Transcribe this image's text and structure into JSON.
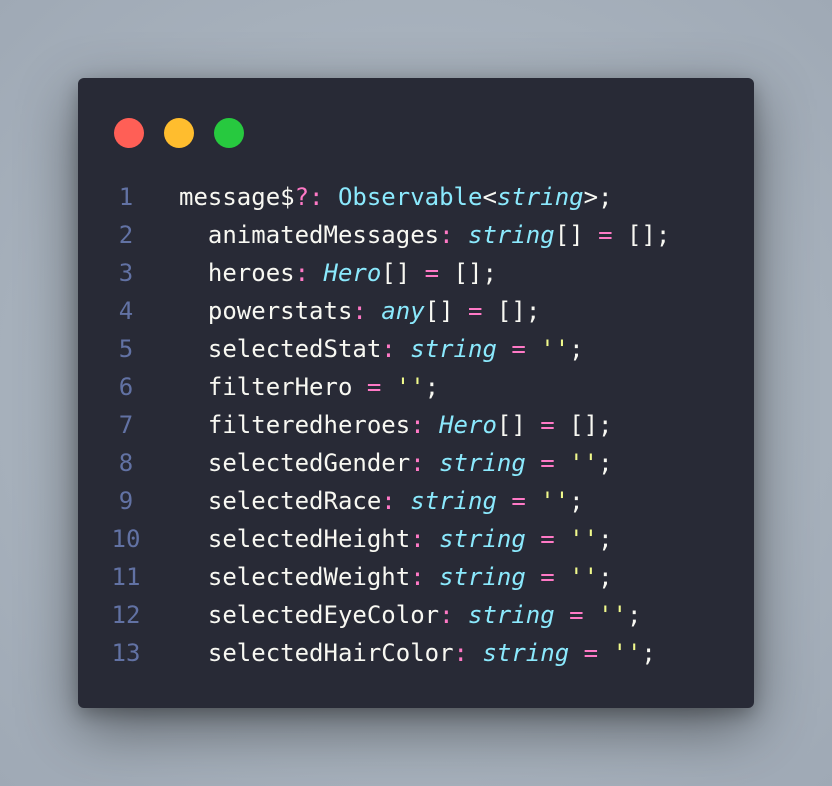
{
  "window": {
    "controls": [
      {
        "name": "close",
        "color": "#ff5f56"
      },
      {
        "name": "minimize",
        "color": "#ffbd2e"
      },
      {
        "name": "maximize",
        "color": "#27c93f"
      }
    ]
  },
  "theme": {
    "background": "#282a36",
    "identifier": "#f8f8f2",
    "keyword_punct": "#ff79c6",
    "type": "#8be9fd",
    "string": "#f1fa8c",
    "line_number": "#6272a4"
  },
  "code": {
    "lines": [
      {
        "number": "1",
        "tokens": [
          {
            "text": "message$",
            "kind": "ident"
          },
          {
            "text": "?:",
            "kind": "punc"
          },
          {
            "text": " ",
            "kind": "plain"
          },
          {
            "text": "Observable",
            "kind": "cls"
          },
          {
            "text": "<",
            "kind": "plain"
          },
          {
            "text": "string",
            "kind": "type"
          },
          {
            "text": ">;",
            "kind": "plain"
          }
        ]
      },
      {
        "number": "2",
        "tokens": [
          {
            "text": "  animatedMessages",
            "kind": "ident"
          },
          {
            "text": ":",
            "kind": "punc"
          },
          {
            "text": " ",
            "kind": "plain"
          },
          {
            "text": "string",
            "kind": "type"
          },
          {
            "text": "[] ",
            "kind": "plain"
          },
          {
            "text": "=",
            "kind": "punc"
          },
          {
            "text": " [];",
            "kind": "plain"
          }
        ]
      },
      {
        "number": "3",
        "tokens": [
          {
            "text": "  heroes",
            "kind": "ident"
          },
          {
            "text": ":",
            "kind": "punc"
          },
          {
            "text": " ",
            "kind": "plain"
          },
          {
            "text": "Hero",
            "kind": "type"
          },
          {
            "text": "[] ",
            "kind": "plain"
          },
          {
            "text": "=",
            "kind": "punc"
          },
          {
            "text": " [];",
            "kind": "plain"
          }
        ]
      },
      {
        "number": "4",
        "tokens": [
          {
            "text": "  powerstats",
            "kind": "ident"
          },
          {
            "text": ":",
            "kind": "punc"
          },
          {
            "text": " ",
            "kind": "plain"
          },
          {
            "text": "any",
            "kind": "type"
          },
          {
            "text": "[] ",
            "kind": "plain"
          },
          {
            "text": "=",
            "kind": "punc"
          },
          {
            "text": " [];",
            "kind": "plain"
          }
        ]
      },
      {
        "number": "5",
        "tokens": [
          {
            "text": "  selectedStat",
            "kind": "ident"
          },
          {
            "text": ":",
            "kind": "punc"
          },
          {
            "text": " ",
            "kind": "plain"
          },
          {
            "text": "string",
            "kind": "type"
          },
          {
            "text": " ",
            "kind": "plain"
          },
          {
            "text": "=",
            "kind": "punc"
          },
          {
            "text": " ",
            "kind": "plain"
          },
          {
            "text": "''",
            "kind": "str"
          },
          {
            "text": ";",
            "kind": "plain"
          }
        ]
      },
      {
        "number": "6",
        "tokens": [
          {
            "text": "  filterHero",
            "kind": "ident"
          },
          {
            "text": " ",
            "kind": "plain"
          },
          {
            "text": "=",
            "kind": "punc"
          },
          {
            "text": " ",
            "kind": "plain"
          },
          {
            "text": "''",
            "kind": "str"
          },
          {
            "text": ";",
            "kind": "plain"
          }
        ]
      },
      {
        "number": "7",
        "tokens": [
          {
            "text": "  filteredheroes",
            "kind": "ident"
          },
          {
            "text": ":",
            "kind": "punc"
          },
          {
            "text": " ",
            "kind": "plain"
          },
          {
            "text": "Hero",
            "kind": "type"
          },
          {
            "text": "[] ",
            "kind": "plain"
          },
          {
            "text": "=",
            "kind": "punc"
          },
          {
            "text": " [];",
            "kind": "plain"
          }
        ]
      },
      {
        "number": "8",
        "tokens": [
          {
            "text": "  selectedGender",
            "kind": "ident"
          },
          {
            "text": ":",
            "kind": "punc"
          },
          {
            "text": " ",
            "kind": "plain"
          },
          {
            "text": "string",
            "kind": "type"
          },
          {
            "text": " ",
            "kind": "plain"
          },
          {
            "text": "=",
            "kind": "punc"
          },
          {
            "text": " ",
            "kind": "plain"
          },
          {
            "text": "''",
            "kind": "str"
          },
          {
            "text": ";",
            "kind": "plain"
          }
        ]
      },
      {
        "number": "9",
        "tokens": [
          {
            "text": "  selectedRace",
            "kind": "ident"
          },
          {
            "text": ":",
            "kind": "punc"
          },
          {
            "text": " ",
            "kind": "plain"
          },
          {
            "text": "string",
            "kind": "type"
          },
          {
            "text": " ",
            "kind": "plain"
          },
          {
            "text": "=",
            "kind": "punc"
          },
          {
            "text": " ",
            "kind": "plain"
          },
          {
            "text": "''",
            "kind": "str"
          },
          {
            "text": ";",
            "kind": "plain"
          }
        ]
      },
      {
        "number": "10",
        "tokens": [
          {
            "text": "  selectedHeight",
            "kind": "ident"
          },
          {
            "text": ":",
            "kind": "punc"
          },
          {
            "text": " ",
            "kind": "plain"
          },
          {
            "text": "string",
            "kind": "type"
          },
          {
            "text": " ",
            "kind": "plain"
          },
          {
            "text": "=",
            "kind": "punc"
          },
          {
            "text": " ",
            "kind": "plain"
          },
          {
            "text": "''",
            "kind": "str"
          },
          {
            "text": ";",
            "kind": "plain"
          }
        ]
      },
      {
        "number": "11",
        "tokens": [
          {
            "text": "  selectedWeight",
            "kind": "ident"
          },
          {
            "text": ":",
            "kind": "punc"
          },
          {
            "text": " ",
            "kind": "plain"
          },
          {
            "text": "string",
            "kind": "type"
          },
          {
            "text": " ",
            "kind": "plain"
          },
          {
            "text": "=",
            "kind": "punc"
          },
          {
            "text": " ",
            "kind": "plain"
          },
          {
            "text": "''",
            "kind": "str"
          },
          {
            "text": ";",
            "kind": "plain"
          }
        ]
      },
      {
        "number": "12",
        "tokens": [
          {
            "text": "  selectedEyeColor",
            "kind": "ident"
          },
          {
            "text": ":",
            "kind": "punc"
          },
          {
            "text": " ",
            "kind": "plain"
          },
          {
            "text": "string",
            "kind": "type"
          },
          {
            "text": " ",
            "kind": "plain"
          },
          {
            "text": "=",
            "kind": "punc"
          },
          {
            "text": " ",
            "kind": "plain"
          },
          {
            "text": "''",
            "kind": "str"
          },
          {
            "text": ";",
            "kind": "plain"
          }
        ]
      },
      {
        "number": "13",
        "tokens": [
          {
            "text": "  selectedHairColor",
            "kind": "ident"
          },
          {
            "text": ":",
            "kind": "punc"
          },
          {
            "text": " ",
            "kind": "plain"
          },
          {
            "text": "string",
            "kind": "type"
          },
          {
            "text": " ",
            "kind": "plain"
          },
          {
            "text": "=",
            "kind": "punc"
          },
          {
            "text": " ",
            "kind": "plain"
          },
          {
            "text": "''",
            "kind": "str"
          },
          {
            "text": ";",
            "kind": "plain"
          }
        ]
      }
    ]
  }
}
